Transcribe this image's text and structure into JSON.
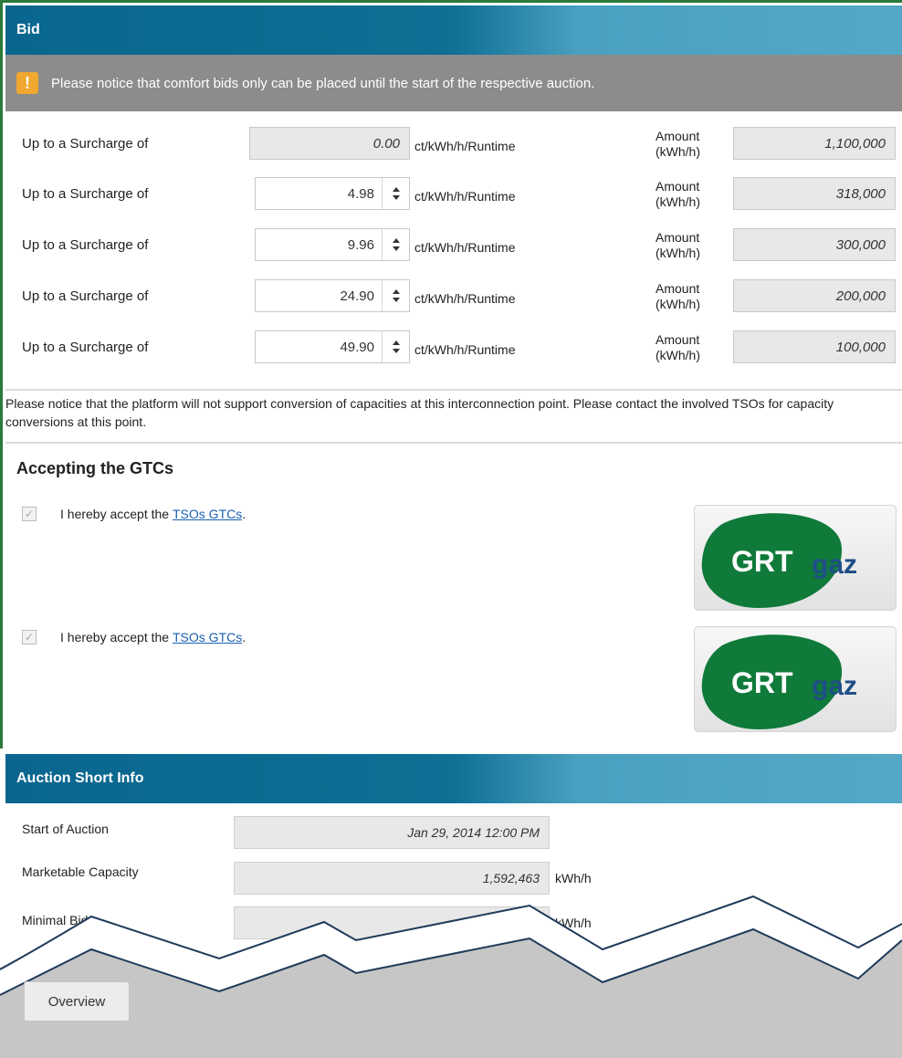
{
  "bid": {
    "title": "Bid",
    "notice": "Please notice that comfort bids only can be placed until the start of the respective auction.",
    "rows": [
      {
        "label": "Up to a Surcharge of",
        "surcharge": "0.00",
        "unit": "ct/kWh/h/Runtime",
        "amount_label": "Amount (kWh/h)",
        "amount": "1,100,000"
      },
      {
        "label": "Up to a Surcharge of",
        "surcharge": "4.98",
        "unit": "ct/kWh/h/Runtime",
        "amount_label": "Amount (kWh/h)",
        "amount": "318,000"
      },
      {
        "label": "Up to a Surcharge of",
        "surcharge": "9.96",
        "unit": "ct/kWh/h/Runtime",
        "amount_label": "Amount (kWh/h)",
        "amount": "300,000"
      },
      {
        "label": "Up to a Surcharge of",
        "surcharge": "24.90",
        "unit": "ct/kWh/h/Runtime",
        "amount_label": "Amount (kWh/h)",
        "amount": "200,000"
      },
      {
        "label": "Up to a Surcharge of",
        "surcharge": "49.90",
        "unit": "ct/kWh/h/Runtime",
        "amount_label": "Amount (kWh/h)",
        "amount": "100,000"
      }
    ],
    "conversion_notice": "Please notice that the platform will not support conversion of capacities at this interconnection point. Please contact the involved TSOs for capacity conversions at this point."
  },
  "gtc": {
    "title": "Accepting the GTCs",
    "items": [
      {
        "text": "I hereby accept the ",
        "link": "TSOs GTCs",
        "suffix": ".",
        "checked": true,
        "logo": "GRTgaz"
      },
      {
        "text": "I hereby accept the ",
        "link": "TSOs GTCs",
        "suffix": ".",
        "checked": true,
        "logo": "GRTgaz"
      }
    ]
  },
  "auction_info": {
    "title": "Auction Short Info",
    "start_label": "Start of Auction",
    "start_value": "Jan 29, 2014 12:00 PM",
    "capacity_label": "Marketable Capacity",
    "capacity_value": "1,592,463",
    "capacity_unit": "kWh/h",
    "minbid_label": "Minimal Bid",
    "minbid_unit": "kWh/h"
  },
  "footer": {
    "overview_label": "Overview"
  },
  "colors": {
    "header": "#0a668f",
    "notice_bar": "#8c8c8c",
    "warning": "#f0a830",
    "logo_green": "#0f7a3a",
    "logo_blue": "#1f4f86"
  }
}
